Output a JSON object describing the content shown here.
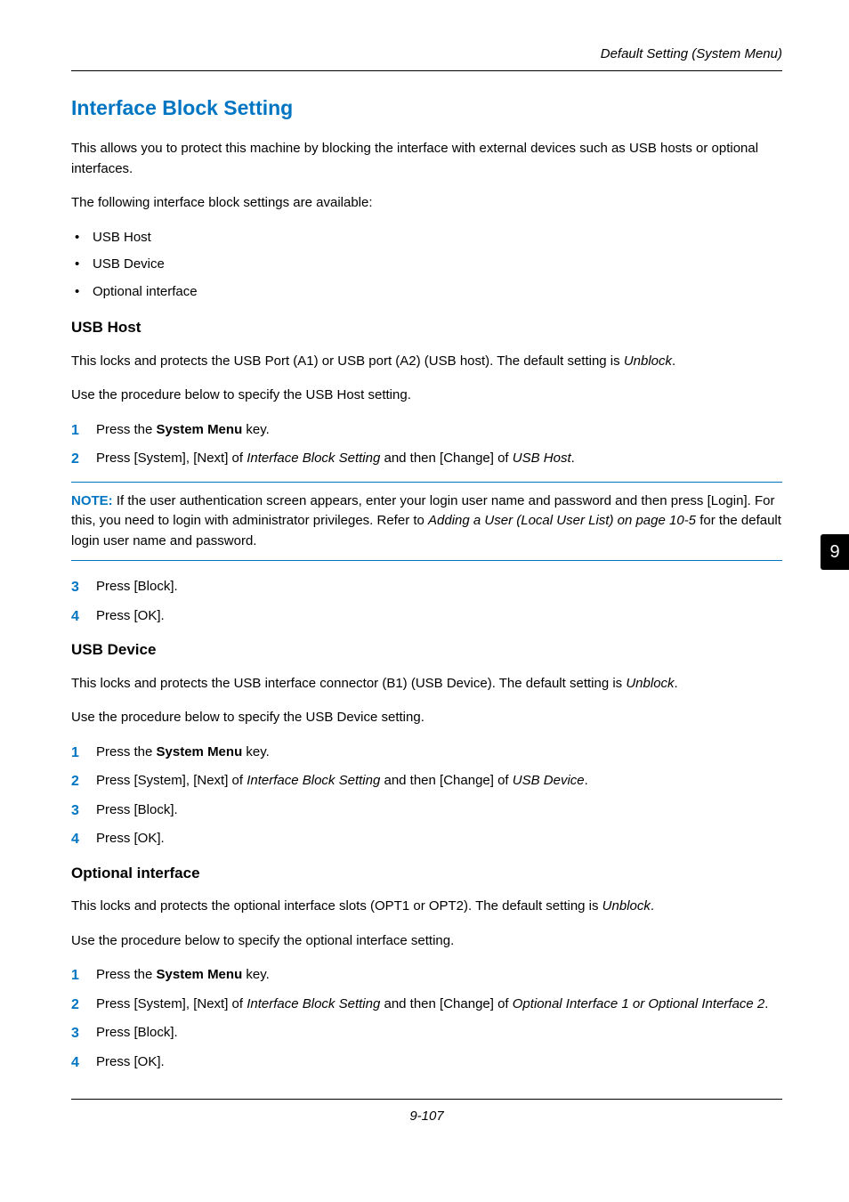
{
  "header": {
    "running_head": "Default Setting (System Menu)"
  },
  "title": "Interface Block Setting",
  "intro": "This allows you to protect this machine by blocking the interface with external devices such as USB hosts or optional interfaces.",
  "available_label": "The following interface block settings are available:",
  "bullets": [
    "USB Host",
    "USB Device",
    "Optional interface"
  ],
  "sections": {
    "usbhost": {
      "heading": "USB Host",
      "p1_pre": "This locks and protects the USB Port (A1) or USB port (A2) (USB host). The default setting is ",
      "p1_em": "Unblock",
      "p1_post": ".",
      "p2": "Use the procedure below to specify the USB Host setting.",
      "steps12": {
        "s1_pre": "Press the ",
        "s1_bold": "System Menu",
        "s1_post": " key.",
        "s2_a": "Press [System], [Next] of ",
        "s2_em1": "Interface Block Setting",
        "s2_b": " and then [Change] of ",
        "s2_em2": "USB Host",
        "s2_c": "."
      },
      "note": {
        "label": "NOTE:",
        "text_a": " If the user authentication screen appears, enter your login user name and password and then press [Login]. For this, you need to login with administrator privileges. Refer to ",
        "em": "Adding a User (Local User List) on page 10-5",
        "text_b": " for the default login user name and password."
      },
      "steps34": {
        "s3": "Press [Block].",
        "s4": "Press [OK]."
      }
    },
    "usbdevice": {
      "heading": "USB Device",
      "p1_pre": "This locks and protects the USB interface connector (B1) (USB Device). The default setting is ",
      "p1_em": "Unblock",
      "p1_post": ".",
      "p2": "Use the procedure below to specify the USB Device setting.",
      "steps": {
        "s1_pre": "Press the ",
        "s1_bold": "System Menu",
        "s1_post": " key.",
        "s2_a": "Press [System], [Next] of ",
        "s2_em1": "Interface Block Setting",
        "s2_b": " and then [Change] of ",
        "s2_em2": "USB Device",
        "s2_c": ".",
        "s3": "Press [Block].",
        "s4": "Press [OK]."
      }
    },
    "optional": {
      "heading": "Optional interface",
      "p1_pre": "This locks and protects the optional interface slots (OPT1 or OPT2). The default setting is ",
      "p1_em": "Unblock",
      "p1_post": ".",
      "p2": "Use the procedure below to specify the optional interface setting.",
      "steps": {
        "s1_pre": "Press the ",
        "s1_bold": "System Menu",
        "s1_post": " key.",
        "s2_a": "Press [System], [Next] of ",
        "s2_em1": "Interface Block Setting",
        "s2_b": " and then [Change] of ",
        "s2_em2": "Optional Interface 1 or Optional Interface 2",
        "s2_c": ".",
        "s3": "Press [Block].",
        "s4": "Press [OK]."
      }
    }
  },
  "tab": "9",
  "footer": "9-107"
}
